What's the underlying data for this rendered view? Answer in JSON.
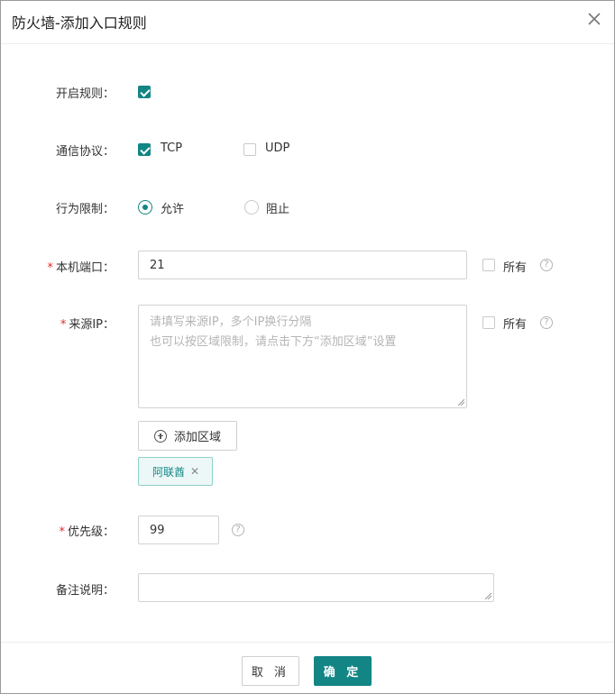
{
  "dialog": {
    "title": "防火墙-添加入口规则"
  },
  "form": {
    "enable_rule": {
      "label": "开启规则：",
      "checked": true
    },
    "protocol": {
      "label": "通信协议：",
      "options": [
        {
          "label": "TCP",
          "checked": true
        },
        {
          "label": "UDP",
          "checked": false
        }
      ]
    },
    "action": {
      "label": "行为限制：",
      "options": [
        {
          "label": "允许",
          "selected": true
        },
        {
          "label": "阻止",
          "selected": false
        }
      ]
    },
    "local_port": {
      "required_mark": "*",
      "label": "本机端口：",
      "value": "21",
      "all_label": "所有"
    },
    "source_ip": {
      "required_mark": "*",
      "label": "来源IP：",
      "placeholder_line1": "请填写来源IP，多个IP换行分隔",
      "placeholder_line2": "也可以按区域限制，请点击下方“添加区域”设置",
      "all_label": "所有",
      "add_region_label": "添加区域",
      "regions": [
        {
          "label": "阿联酋"
        }
      ]
    },
    "priority": {
      "required_mark": "*",
      "label": "优先级：",
      "value": "99"
    },
    "note": {
      "label": "备注说明：",
      "value": ""
    }
  },
  "footer": {
    "cancel_label": "取 消",
    "ok_label": "确 定"
  },
  "theme": {
    "accent": "#138585",
    "required": "#e02b2b",
    "tag_bg": "#ecf8f7"
  }
}
